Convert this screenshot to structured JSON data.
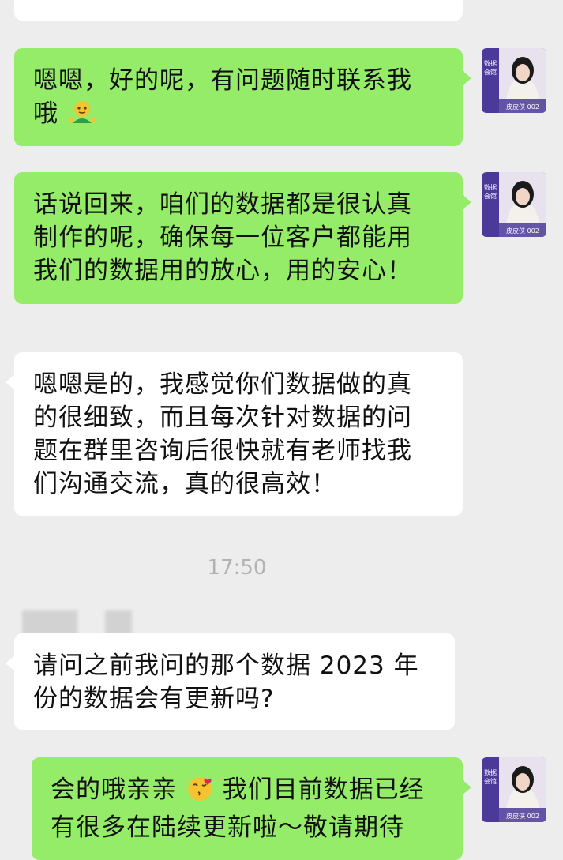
{
  "messages": [
    {
      "side": "right",
      "text": "嗯嗯，好的呢，有问题随时联系我哦",
      "emoji": "shrug-emoji"
    },
    {
      "side": "right",
      "text": "话说回来，咱们的数据都是很认真制作的呢，确保每一位客户都能用我们的数据用的放心，用的安心！"
    },
    {
      "side": "left",
      "text": "嗯嗯是的，我感觉你们数据做的真的很细致，而且每次针对数据的问题在群里咨询后很快就有老师找我们沟通交流，真的很高效！"
    },
    {
      "side": "left",
      "text": "请问之前我问的那个数据 2023 年份的数据会有更新吗?"
    },
    {
      "side": "right",
      "text_a": "会的哦亲亲",
      "emoji": "kissing-face-emoji",
      "text_b": "我们目前数据已经有很多在陆续更新啦～敬请期待"
    }
  ],
  "lines": {
    "m1": [
      "嗯嗯，好的呢，有问题随时联系我",
      "哦"
    ],
    "m2": [
      "话说回来，咱们的数据都是很认真",
      "制作的呢，确保每一位客户都能用",
      "我们的数据用的放心，用的安心！"
    ],
    "m3": [
      "嗯嗯是的，我感觉你们数据做的真",
      "的很细致，而且每次针对数据的问",
      "题在群里咨询后很快就有老师找我",
      "们沟通交流，真的很高效！"
    ],
    "m4": [
      "请问之前我问的那个数据 2023 年",
      "份的数据会有更新吗?"
    ],
    "m5a": "会的哦亲亲",
    "m5b": "我们目前数据已经",
    "m5c": "有很多在陆续更新啦～敬请期待"
  },
  "timestamp": "17:50",
  "avatar": {
    "badge_text_top": "数据",
    "badge_text_bottom": "会馆",
    "name_tag": "皮皮侠 002"
  },
  "colors": {
    "background": "#ededed",
    "outgoing_bubble": "#95ec69",
    "incoming_bubble": "#ffffff",
    "avatar_purple": "#4b3a9a"
  }
}
